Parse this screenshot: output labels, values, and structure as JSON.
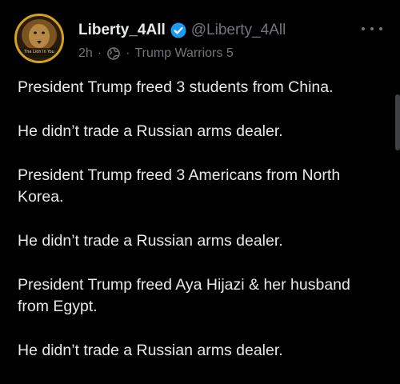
{
  "post": {
    "author": {
      "display_name": "Liberty_4All",
      "handle": "@Liberty_4All",
      "verified": true,
      "avatar_icon": "lion-avatar-icon",
      "avatar_caption": "The Lion in You"
    },
    "timestamp": "2h",
    "separator": "·",
    "community_icon": "community-globe-icon",
    "community": "Trump Warriors 5",
    "paragraphs": [
      "President Trump freed 3 students from China.",
      "He didn’t trade a Russian arms dealer.",
      "President Trump freed 3 Americans from North Korea.",
      "He didn’t trade a Russian arms dealer.",
      "President Trump freed Aya Hijazi & her husband from Egypt.",
      "He didn’t trade a Russian arms dealer."
    ]
  },
  "colors": {
    "background": "#000000",
    "text": "#e7e9ea",
    "muted": "#71767b",
    "verified": "#1d9bf0",
    "avatar_ring": "#d4a21c"
  }
}
